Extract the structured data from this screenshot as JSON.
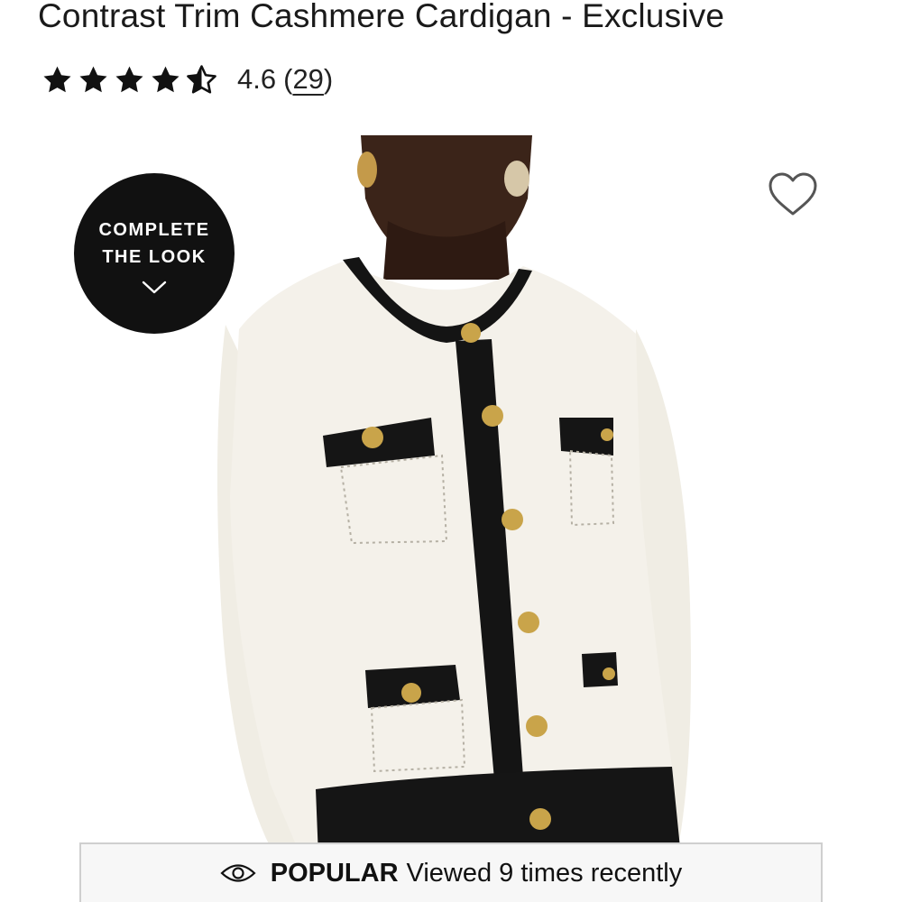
{
  "product": {
    "title": "Contrast Trim Cashmere Cardigan - Exclusive",
    "rating": {
      "value": "4.6",
      "count": "29",
      "paren_open": "(",
      "paren_close": ")",
      "stars": 4.5,
      "stars_max": 5,
      "star_icon": "star-icon"
    }
  },
  "complete_look": {
    "line1": "COMPLETE",
    "line2": "THE LOOK",
    "icon": "chevron-down-icon"
  },
  "wishlist": {
    "icon": "heart-outline-icon"
  },
  "popular": {
    "icon": "eye-icon",
    "label": "POPULAR",
    "text": "Viewed 9 times recently"
  },
  "colors": {
    "badge_bg": "#111111",
    "text": "#1a1a1a",
    "banner_bg": "#f7f7f7",
    "banner_border": "#cfcfcf"
  }
}
